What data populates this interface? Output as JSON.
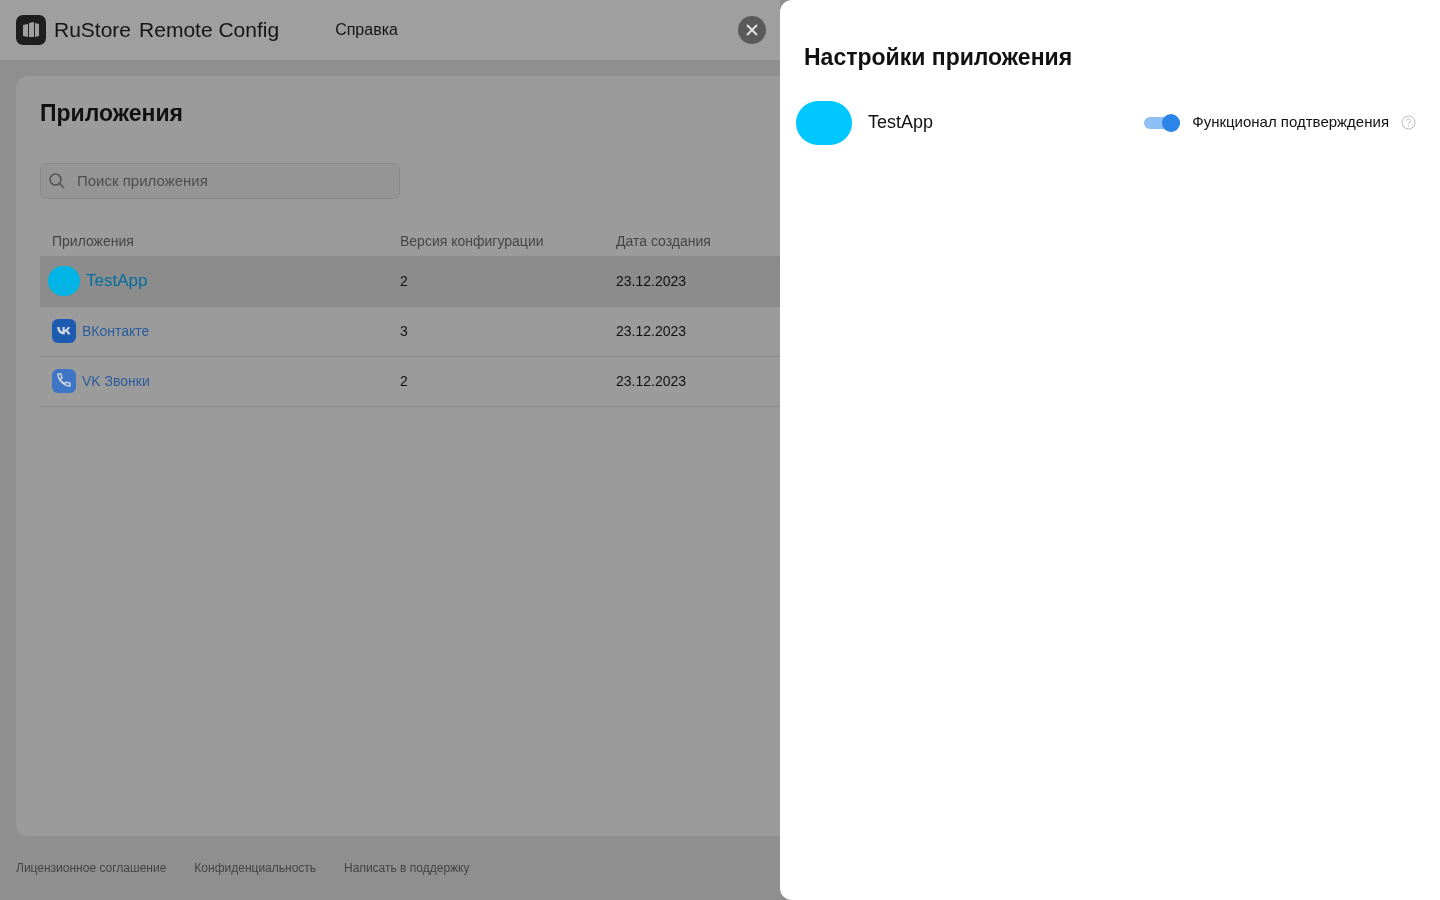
{
  "header": {
    "logo_text": "RuStore",
    "product": "Remote Config",
    "nav": [
      "Справка"
    ]
  },
  "page": {
    "title": "Приложения",
    "search": {
      "placeholder": "Поиск приложения"
    },
    "table": {
      "columns": [
        "Приложения",
        "Версия конфигурации",
        "Дата создания"
      ],
      "rows": [
        {
          "kind": "blob",
          "name": "TestApp",
          "version": "2",
          "date": "23.12.2023",
          "selected": true
        },
        {
          "kind": "vk",
          "name": "ВКонтакте",
          "version": "3",
          "date": "23.12.2023",
          "selected": false
        },
        {
          "kind": "calls",
          "name": "VK Звонки",
          "version": "2",
          "date": "23.12.2023",
          "selected": false
        }
      ]
    }
  },
  "footer": [
    "Лицензионное соглашение",
    "Конфиденциальность",
    "Написать в поддержку"
  ],
  "drawer": {
    "title": "Настройки приложения",
    "app_name": "TestApp",
    "toggle": {
      "label": "Функционал подтверждения",
      "on": true
    }
  }
}
